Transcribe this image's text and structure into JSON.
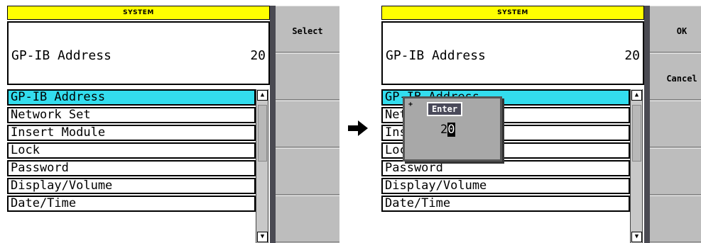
{
  "left": {
    "title": "SYSTEM",
    "param_name": "GP-IB Address",
    "param_value": "20",
    "items": [
      "GP-IB Address",
      "Network Set",
      "Insert Module",
      "Lock",
      "Password",
      "Display/Volume",
      "Date/Time"
    ],
    "softkeys": [
      "Select",
      "",
      "",
      "",
      ""
    ]
  },
  "right": {
    "title": "SYSTEM",
    "param_name": "GP-IB Address",
    "param_value": "20",
    "items": [
      "GP-IB Address",
      "Network Set",
      "Insert Module",
      "Lock",
      "Password",
      "Display/Volume",
      "Date/Time"
    ],
    "softkeys": [
      "OK",
      "Cancel",
      "",
      "",
      ""
    ],
    "popup": {
      "title": "Enter",
      "value_first": "2",
      "value_second": "0",
      "marker": "+"
    }
  },
  "icons": {
    "scroll_up": "▲",
    "scroll_down": "▼",
    "transition": "right-arrow-icon"
  },
  "colors": {
    "title_bg": "#ffff00",
    "selected_bg": "#33ddee",
    "softkey_bg": "#bdbdbd",
    "divider": "#4a4a52"
  }
}
